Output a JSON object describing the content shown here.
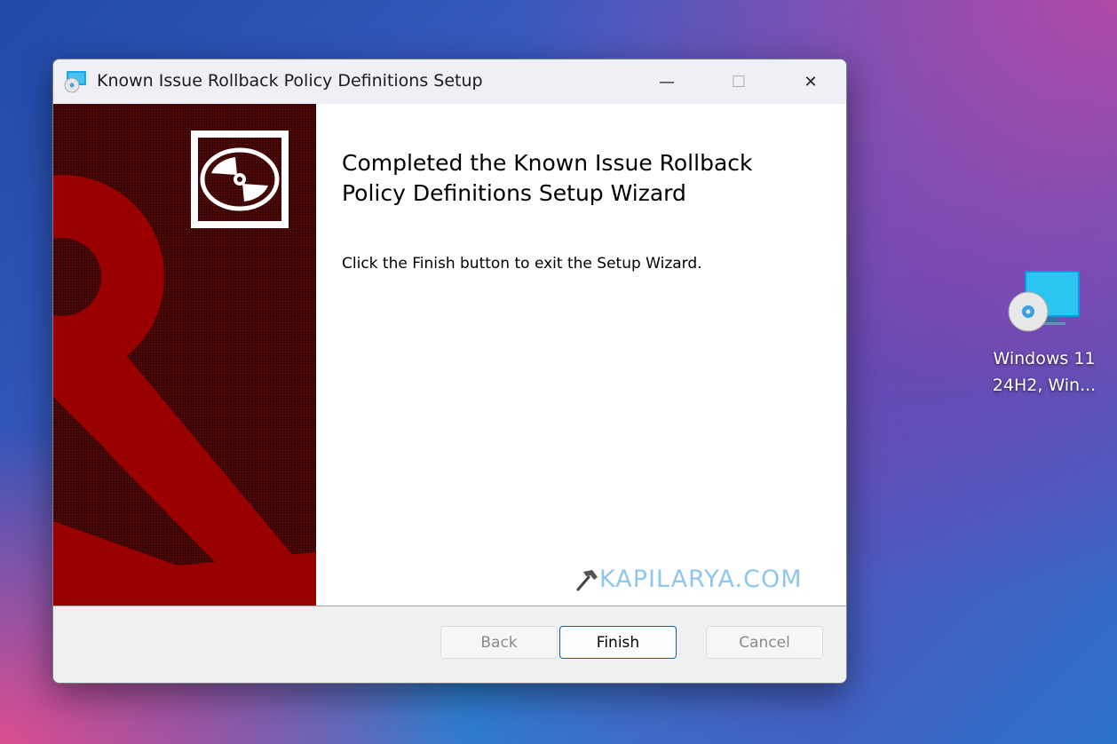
{
  "window": {
    "title": "Known Issue Rollback Policy Definitions Setup",
    "controls": {
      "minimize": "—",
      "maximize": "☐",
      "close": "✕"
    }
  },
  "wizard": {
    "heading": "Completed the Known Issue Rollback Policy Definitions Setup Wizard",
    "body": "Click the Finish button to exit the Setup Wizard.",
    "watermark": "KAPILARYA.COM"
  },
  "buttons": {
    "back": "Back",
    "finish": "Finish",
    "cancel": "Cancel"
  },
  "desktop": {
    "icon_label_line1": "Windows 11",
    "icon_label_line2": "24H2, Win..."
  },
  "colors": {
    "banner_dark": "#4a0a0a",
    "banner_red": "#9a0000",
    "finish_border": "#0a5fb5",
    "watermark": "#8fc6ec"
  },
  "icons": [
    "setup-app-icon",
    "minimize-icon",
    "maximize-icon",
    "close-icon",
    "installer-disc-icon",
    "desktop-shortcut-icon"
  ]
}
